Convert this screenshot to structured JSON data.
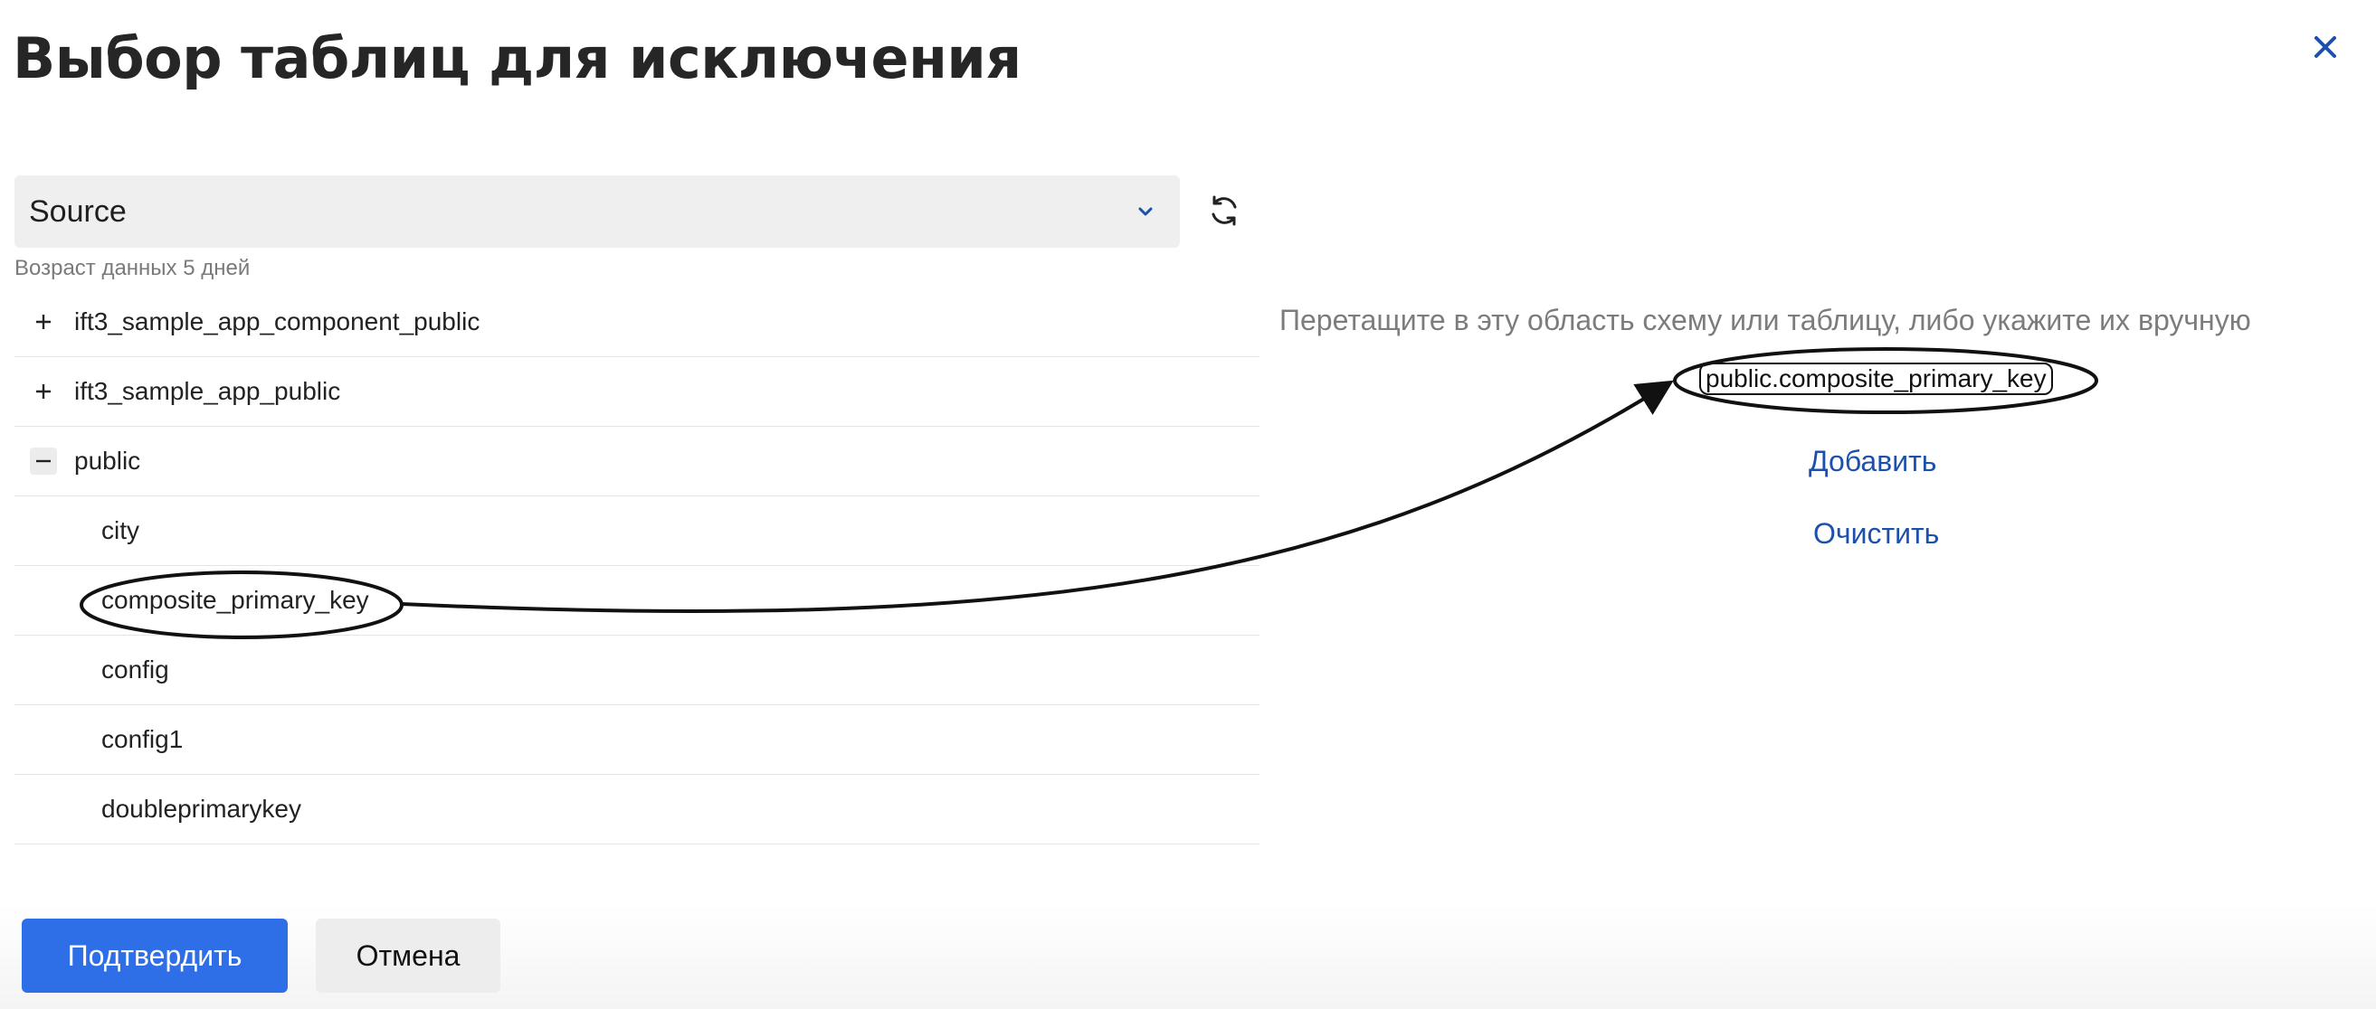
{
  "dialog": {
    "title": "Выбор таблиц для исключения",
    "close_icon": "close-icon"
  },
  "source_select": {
    "value": "Source",
    "chevron_icon": "chevron-down-icon",
    "refresh_icon": "refresh-icon",
    "data_age": "Возраст данных 5 дней"
  },
  "tree": {
    "rows": [
      {
        "label": "ift3_sample_app_component_public",
        "toggle": "+",
        "toggle_icon": "plus-icon"
      },
      {
        "label": "ift3_sample_app_public",
        "toggle": "+",
        "toggle_icon": "plus-icon"
      },
      {
        "label": "public",
        "toggle": "−",
        "toggle_icon": "minus-icon"
      },
      {
        "label": "city"
      },
      {
        "label": "composite_primary_key"
      },
      {
        "label": "config"
      },
      {
        "label": "config1"
      },
      {
        "label": "doubleprimarykey"
      }
    ]
  },
  "exclusion_area": {
    "hint": "Перетащите в эту область схему или таблицу, либо укажите их вручную",
    "entry": "public.composite_primary_key",
    "add_label": "Добавить",
    "clear_label": "Очистить"
  },
  "footer": {
    "confirm_label": "Подтвердить",
    "cancel_label": "Отмена"
  },
  "colors": {
    "primary": "#2e6ee6",
    "link": "#1d50ae",
    "select_bg": "#efefef",
    "annotation": "#111111"
  }
}
